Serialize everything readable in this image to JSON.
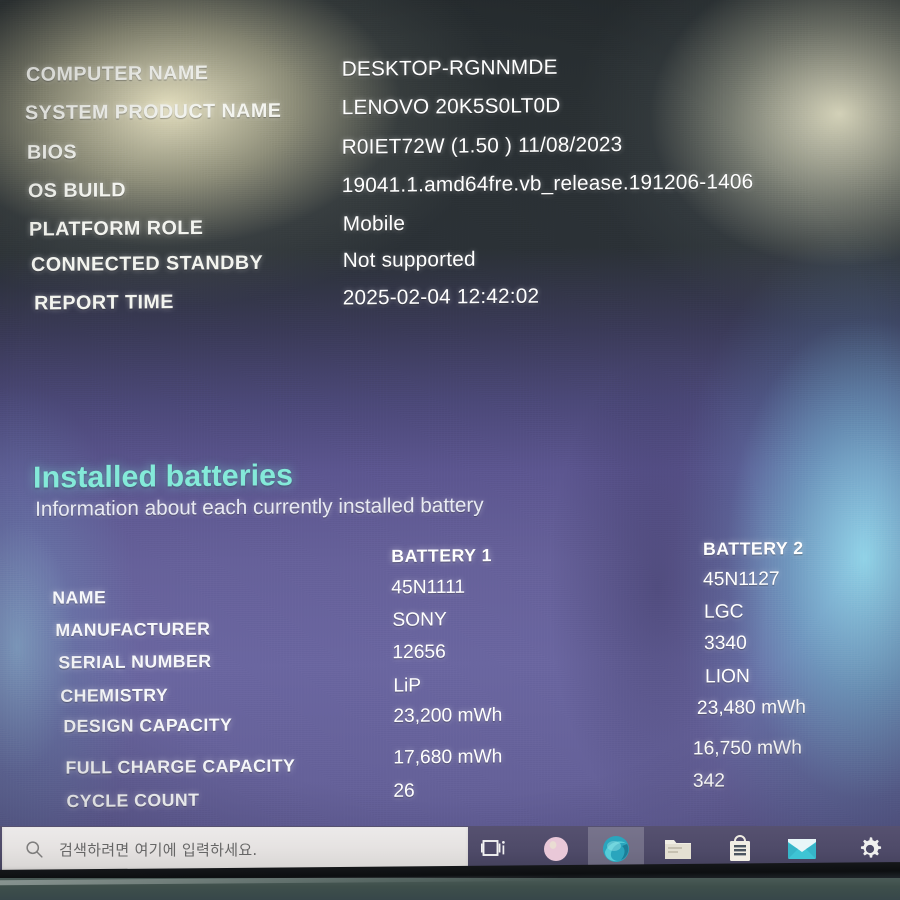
{
  "report": {
    "system_rows": [
      {
        "label": "COMPUTER NAME",
        "value": "DESKTOP-RGNNMDE"
      },
      {
        "label": "SYSTEM PRODUCT NAME",
        "value": "LENOVO 20K5S0LT0D"
      },
      {
        "label": "BIOS",
        "value": "R0IET72W (1.50 ) 11/08/2023"
      },
      {
        "label": "OS BUILD",
        "value": "19041.1.amd64fre.vb_release.191206-1406"
      },
      {
        "label": "PLATFORM ROLE",
        "value": "Mobile"
      },
      {
        "label": "CONNECTED STANDBY",
        "value": "Not supported"
      },
      {
        "label": "REPORT TIME",
        "value": "2025-02-04  12:42:02"
      }
    ],
    "batteries_section": {
      "title": "Installed batteries",
      "subtitle": "Information about each currently installed battery",
      "column_headers": [
        "BATTERY 1",
        "BATTERY 2"
      ],
      "rows": [
        {
          "label": "NAME",
          "battery1": "45N1111",
          "battery2": "45N1127"
        },
        {
          "label": "MANUFACTURER",
          "battery1": "SONY",
          "battery2": "LGC"
        },
        {
          "label": "SERIAL NUMBER",
          "battery1": "12656",
          "battery2": "3340"
        },
        {
          "label": "CHEMISTRY",
          "battery1": "LiP",
          "battery2": "LION"
        },
        {
          "label": "DESIGN CAPACITY",
          "battery1": "23,200 mWh",
          "battery2": "23,480 mWh"
        },
        {
          "label": "FULL CHARGE CAPACITY",
          "battery1": "17,680 mWh",
          "battery2": "16,750 mWh"
        },
        {
          "label": "CYCLE COUNT",
          "battery1": "26",
          "battery2": "342"
        }
      ]
    },
    "accent_color": "#84ead9",
    "text_color": "#ffffff"
  },
  "taskbar": {
    "search": {
      "placeholder": "검색하려면 여기에 입력하세요.",
      "icon": "search-icon"
    },
    "buttons": [
      {
        "name": "task-view",
        "icon": "task-view-icon"
      },
      {
        "name": "cortana",
        "icon": "cortana-icon"
      },
      {
        "name": "microsoft-edge",
        "icon": "edge-icon"
      },
      {
        "name": "file-explorer",
        "icon": "folder-icon"
      },
      {
        "name": "microsoft-store",
        "icon": "store-bag-icon"
      },
      {
        "name": "mail",
        "icon": "mail-icon"
      },
      {
        "name": "settings",
        "icon": "gear-icon"
      }
    ]
  }
}
